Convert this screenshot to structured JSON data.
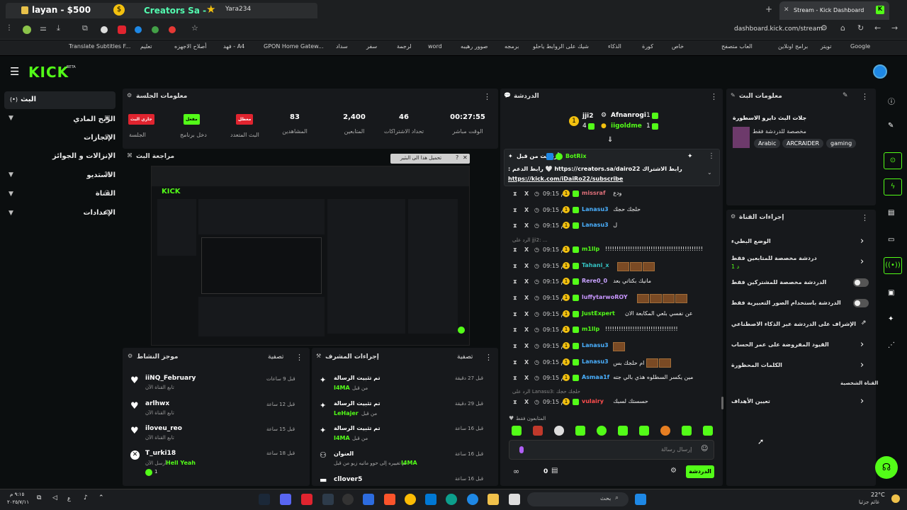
{
  "browser": {
    "tab_left_title": "layan - $500",
    "tab_overlay_title": "Creators Sa -",
    "tab_overlay_user": "Yara234",
    "active_tab_title": "Stream - Kick Dashboard",
    "new_tab": "+",
    "close_tab": "✕",
    "url": "dashboard.kick.com/stream",
    "bookmarks": [
      "Google",
      "تويتر",
      "برامج اونلاين",
      "العاب متصفح",
      "خاص",
      "كورة",
      "الذكاء",
      "شيك على الروابط ياحلو",
      "برمجه",
      "صوور رهيبه",
      "word",
      "لرجمة",
      "سفر",
      "سداد",
      "GPON Home Gatew...",
      "فهد - A4",
      "أصلاح الاجهزه",
      "تعليم",
      "Translate Subtitles F..."
    ]
  },
  "sidebar": {
    "logo": "KICK",
    "logo_beta": "BETA",
    "items": [
      {
        "label": "البث",
        "icon": "(•)"
      },
      {
        "label": "الربح المادي",
        "icon": "▣"
      },
      {
        "label": "الإنجازات",
        "icon": "🏆"
      },
      {
        "label": "الإنزالات و الجوائز",
        "icon": ""
      },
      {
        "label": "الاستديو",
        "icon": "⌘"
      },
      {
        "label": "القناة",
        "icon": "⚇"
      },
      {
        "label": "الإعدادات",
        "icon": "⚙"
      }
    ]
  },
  "session": {
    "title": "معلومات الجلسة",
    "stats": [
      {
        "value": "00:27:55",
        "label": "الوقت مباشر"
      },
      {
        "value": "46",
        "label": "تحداد الاشتراكات"
      },
      {
        "value": "2,400",
        "label": "المتابعين"
      },
      {
        "value": "83",
        "label": "المشاهدين"
      }
    ],
    "buttons": [
      {
        "label": "معطل",
        "sub": "البث المتعدد",
        "color": "#e0242f"
      },
      {
        "label": "مفعل",
        "sub": "دخل برنامج",
        "color": "#53fc18"
      },
      {
        "label": "جاري البث",
        "sub": "الجلسة",
        "color": "#e0242f"
      }
    ],
    "preview_title": "مراجعة البث",
    "preview_popup": "تحميل هذا الى البثير"
  },
  "activity": {
    "title": "موجز النشاط",
    "filter": "تصفية",
    "items": [
      {
        "name": "iiNQ_February",
        "desc": "تابع القناة الآن",
        "time": "قبل 9 ساعات"
      },
      {
        "name": "arlhwx",
        "desc": "تابع القناة الآن",
        "time": "قبل 12 ساعة"
      },
      {
        "name": "iloveu_reo",
        "desc": "تابع القناة الآن",
        "time": "قبل 15 ساعة"
      },
      {
        "name": "T_urki18",
        "desc": "أرسل الآن",
        "extra": "Hell Yeah",
        "time": "قبل 18 ساعة"
      }
    ]
  },
  "mod_actions": {
    "title": "إجراءات المشرف",
    "filter": "تصفية",
    "items": [
      {
        "action": "تم تثبيت الرسالة",
        "by": "I4MA",
        "prefix": "من قبل",
        "time": "قبل 27 دقيقة"
      },
      {
        "action": "تم تثبيت الرسالة",
        "by": "LeHajer",
        "prefix": "من قبل",
        "time": "قبل 29 دقيقة"
      },
      {
        "action": "تم تثبيت الرسالة",
        "by": "I4MA",
        "prefix": "من قبل",
        "time": "قبل 16 ساعة"
      },
      {
        "action": "العنوان",
        "by": "I4MA",
        "prefix": "تم تغييره إلى حوو ماتيه زيو من قبل",
        "time": "قبل 16 ساعة"
      },
      {
        "action": "cllover5",
        "by": "",
        "prefix": "",
        "time": "قبل 16 ساعة"
      }
    ]
  },
  "chat": {
    "title": "الدردشة",
    "top": [
      {
        "rank": "1",
        "name": "Afnanrogi",
        "count": "1"
      },
      {
        "rank": "",
        "name": "iigoldme",
        "count": "1"
      },
      {
        "rank": "",
        "name": "jji2",
        "count": "4"
      }
    ],
    "pinned_by": "أرسلت من قبل",
    "pinned_user": "BotRix",
    "pinned_line1": "رابط الاشتراك https://creators.sa/dairo22 🤍 رابط الدعم :",
    "pinned_line2": "https://kick.com/iDaiRo22/subscribe",
    "messages": [
      {
        "time": "09:15 م",
        "user": "missraf",
        "color": "#e0707a",
        "text": "ودع"
      },
      {
        "time": "09:15 م",
        "user": "Lanasu3",
        "color": "#4ab0ff",
        "text": "حلجك حجك"
      },
      {
        "time": "09:15 م",
        "user": "Lanasu3",
        "color": "#4ab0ff",
        "text": "ل"
      },
      {
        "time": "09:15 م",
        "user": "m1llp",
        "color": "#53fc18",
        "text": "!!!!!!!!!!!!!!!!!!!!!!!!!!!!!!!!!!!!!!!!!!!"
      },
      {
        "time": "09:15 م",
        "user": "Tahani_x",
        "color": "#34c3c3",
        "text": ""
      },
      {
        "time": "09:15 م",
        "user": "Rere0_0",
        "color": "#c8a2ff",
        "text": "مانيك بكتاتي بعد"
      },
      {
        "time": "09:15 م",
        "user": "luffytarwoROY",
        "color": "#c896ff",
        "text": ""
      },
      {
        "time": "09:15 م",
        "user": "JustExpert",
        "color": "#53fc18",
        "text": "عن نفسي بلعي المكابعة الان"
      },
      {
        "time": "09:15 م",
        "user": "m1llp",
        "color": "#53fc18",
        "text": "!!!!!!!!!!!!!!!!!!!!!!!!!!!!!!!!"
      },
      {
        "time": "09:15 م",
        "user": "Lanasu3",
        "color": "#4ab0ff",
        "text": ""
      },
      {
        "time": "09:15 م",
        "user": "Lanasu3",
        "color": "#4ab0ff",
        "text": "ام حلجك بس"
      },
      {
        "time": "09:15 م",
        "user": "Asmaa1f",
        "color": "#4ab0ff",
        "text": "مين يكسر السطلوه هذي بالي جته"
      },
      {
        "time": "09:15 م",
        "user": "vulairy",
        "color": "#ff4d4d",
        "text": "حسستك لسبك"
      }
    ],
    "reply_note_1": "الرد على jji2: ...",
    "reply_note_2": "الرد على Lanasu3: حلجك حجك",
    "followers_only": "المتابعون فقط",
    "input_placeholder": "إرسال رسالة",
    "viewers_count": "0",
    "send_button": "الدردشة"
  },
  "stream_info": {
    "title": "معلومات البث",
    "stream_title": "جلات البث دايرو الاسطورة",
    "category": "مخصصة للدردشة فقط",
    "tags": [
      "Arabic",
      "ARCRAIDER",
      "gaming"
    ]
  },
  "channel_actions": {
    "title": "إجراءات القناة",
    "items": [
      {
        "label": "الوضع البطيء",
        "control": "chevron"
      },
      {
        "label": "دردشة مخصصة للمتابعين فقط",
        "sub": "1 د",
        "control": "chevron"
      },
      {
        "label": "الدردشة مخصصة للمشتركين فقط",
        "control": "toggle"
      },
      {
        "label": "الدردشة باستخدام الصور التعبيرية فقط",
        "control": "toggle"
      },
      {
        "label": "الإشراف على الدردشة عبر الذكاء الاصطناعي",
        "control": "external"
      },
      {
        "label": "القيود المفروضة على عمر الحساب",
        "control": "chevron"
      },
      {
        "label": "الكلمات المحظورة",
        "control": "chevron"
      },
      {
        "label": "القناة الشخصية",
        "control": "none"
      },
      {
        "label": "تعيين الأهداف",
        "control": "chevron"
      }
    ]
  },
  "taskbar": {
    "search": "بحث",
    "time": "٩:١٥ م",
    "date": "٢٠٢٥/٧/١١",
    "weather_temp": "22°C",
    "weather_desc": "غائم جزئيا",
    "lang": "ع"
  },
  "colors": {
    "accent": "#53fc18",
    "live": "#e0242f",
    "panel": "#17191c",
    "bg": "#0b0e0f"
  }
}
